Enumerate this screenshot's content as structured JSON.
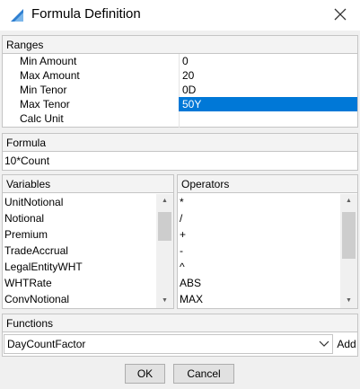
{
  "window": {
    "title": "Formula Definition",
    "app_icon": "triangle-app-icon",
    "close_icon": "close-icon"
  },
  "ranges": {
    "header": "Ranges",
    "rows": [
      {
        "label": "Min Amount",
        "value": "0"
      },
      {
        "label": "Max Amount",
        "value": "20"
      },
      {
        "label": "Min Tenor",
        "value": "0D"
      },
      {
        "label": "Max Tenor",
        "value": "50Y"
      },
      {
        "label": "Calc Unit",
        "value": ""
      }
    ],
    "selected_color": "#0078d7"
  },
  "formula": {
    "header": "Formula",
    "value": "10*Count"
  },
  "variables": {
    "header": "Variables",
    "items": [
      "UnitNotional",
      "Notional",
      "Premium",
      "TradeAccrual",
      "LegalEntityWHT",
      "WHTRate",
      "ConvNotional"
    ]
  },
  "operators": {
    "header": "Operators",
    "items": [
      "*",
      "/",
      "+",
      "-",
      "^",
      "ABS",
      "MAX"
    ]
  },
  "functions": {
    "header": "Functions",
    "selected": "DayCountFactor",
    "add_label": "Add"
  },
  "buttons": {
    "ok": "OK",
    "cancel": "Cancel"
  }
}
